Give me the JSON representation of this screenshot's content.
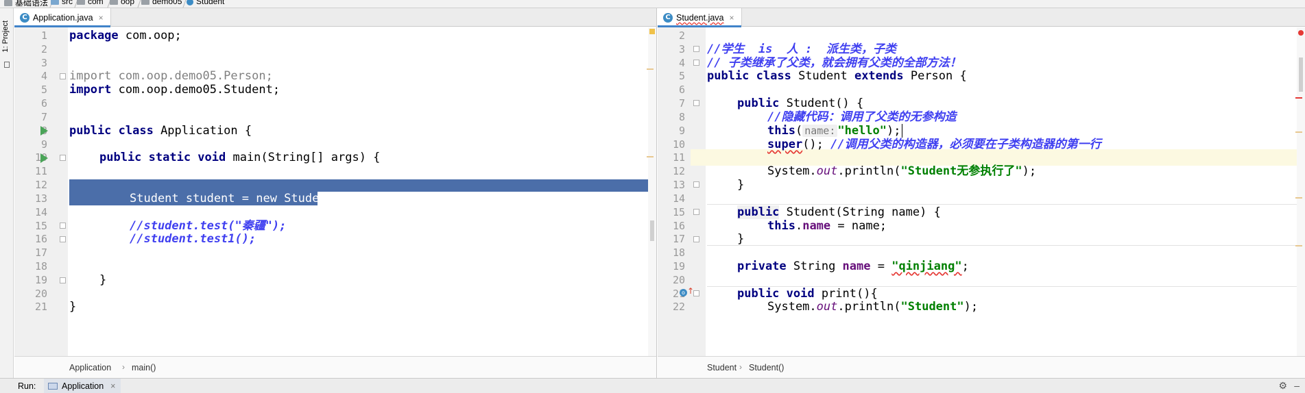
{
  "navbar": {
    "crumbs": [
      "基础语法",
      "src",
      "com",
      "oop",
      "demo05",
      "Student"
    ]
  },
  "sidebar": {
    "project_label": "1: Project"
  },
  "left_editor": {
    "tab_label": "Application.java",
    "tab_icon": "C",
    "close": "×",
    "breadcrumb": [
      "Application",
      "main()"
    ],
    "lines": [
      {
        "n": "1"
      },
      {
        "n": "2"
      },
      {
        "n": "3"
      },
      {
        "n": "4"
      },
      {
        "n": "5"
      },
      {
        "n": "6"
      },
      {
        "n": "7"
      },
      {
        "n": "8"
      },
      {
        "n": "9"
      },
      {
        "n": "10"
      },
      {
        "n": "11"
      },
      {
        "n": "12"
      },
      {
        "n": "13"
      },
      {
        "n": "14"
      },
      {
        "n": "15"
      },
      {
        "n": "16"
      },
      {
        "n": "17"
      },
      {
        "n": "18"
      },
      {
        "n": "19"
      },
      {
        "n": "20"
      },
      {
        "n": "21"
      }
    ],
    "code": {
      "l1_kw": "package",
      "l1_rest": " com.oop;",
      "l4_kw": "import",
      "l4_rest": " com.oop.demo05.Person;",
      "l5_kw": "import",
      "l5_rest": " com.oop.demo05.Student;",
      "l8_kw": "public class",
      "l8_rest": " Application {",
      "l10_kw": "public static void",
      "l10_rest": " main(String[] args) {",
      "l13": "Student student = new Student();",
      "l15": "//student.test(\"秦疆\");",
      "l16": "//student.test1();",
      "l19": "}",
      "l21": "}"
    }
  },
  "right_editor": {
    "tab_label": "Student.java",
    "tab_icon": "C",
    "close": "×",
    "breadcrumb": [
      "Student",
      "Student()"
    ],
    "lines": [
      {
        "n": "2"
      },
      {
        "n": "3"
      },
      {
        "n": "4"
      },
      {
        "n": "5"
      },
      {
        "n": "6"
      },
      {
        "n": "7"
      },
      {
        "n": "8"
      },
      {
        "n": "9"
      },
      {
        "n": "10"
      },
      {
        "n": "11"
      },
      {
        "n": "12"
      },
      {
        "n": "13"
      },
      {
        "n": "14"
      },
      {
        "n": "15"
      },
      {
        "n": "16"
      },
      {
        "n": "17"
      },
      {
        "n": "18"
      },
      {
        "n": "19"
      },
      {
        "n": "20"
      },
      {
        "n": "21"
      },
      {
        "n": "22"
      }
    ],
    "code": {
      "l3": "//学生  is  人 :  派生类，子类",
      "l4": "// 子类继承了父类，就会拥有父类的全部方法！",
      "l5_kw1": "public class",
      "l5_mid": " Student ",
      "l5_kw2": "extends",
      "l5_rest": " Person {",
      "l7_kw": "public",
      "l7_rest": " Student() {",
      "l8": "//隐藏代码：调用了父类的无参构造",
      "l9_kw": "this",
      "l9_open": "(",
      "l9_hint": "name:",
      "l9_str": "\"hello\"",
      "l9_close": ");",
      "l10_kw": "super",
      "l10_mid": "(); ",
      "l10_cmt": "//调用父类的构造器，必须要在子类构造器的第一行",
      "l12_a": "System.",
      "l12_out": "out",
      "l12_b": ".println(",
      "l12_str": "\"Student无参执行了\"",
      "l12_c": ");",
      "l13": "}",
      "l15_kw": "public",
      "l15_rest": " Student(String name) {",
      "l16_kw": "this",
      "l16_dot": ".",
      "l16_fld": "name",
      "l16_rest": " = name;",
      "l17": "}",
      "l19_kw": "private",
      "l19_mid": " String ",
      "l19_fld": "name",
      "l19_eq": " = ",
      "l19_str": "\"qinjiang\"",
      "l19_end": ";",
      "l21_kw": "public void",
      "l21_rest": " print(){",
      "l22_a": "System.",
      "l22_out": "out",
      "l22_b": ".println(",
      "l22_str": "\"Student\"",
      "l22_c": ");"
    }
  },
  "runbar": {
    "label": "Run:",
    "tab_label": "Application",
    "close": "×",
    "gear": "⚙",
    "minus": "–"
  },
  "colors": {
    "keyword": "#000080",
    "string": "#008000",
    "comment": "#3f3ff0",
    "selection": "#4b6ea9",
    "current_line": "#fcf9e1",
    "field": "#660e7a"
  }
}
